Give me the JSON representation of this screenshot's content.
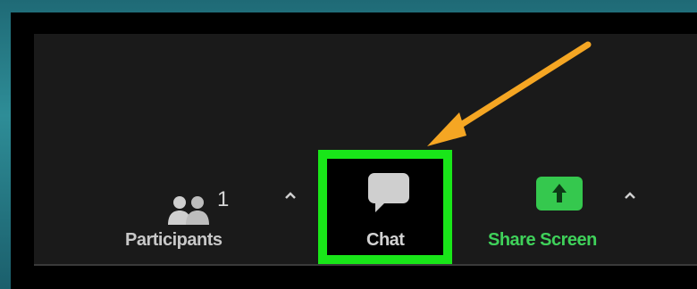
{
  "toolbar": {
    "participants": {
      "label": "Participants",
      "count": "1",
      "icon": "participants-icon"
    },
    "chat": {
      "label": "Chat",
      "icon": "chat-bubble-icon"
    },
    "share_screen": {
      "label": "Share Screen",
      "icon": "share-screen-icon"
    }
  },
  "annotation": {
    "arrow_color": "#f5a623",
    "highlight_color": "#19e619"
  },
  "colors": {
    "share_green": "#3fd15a",
    "toolbar_bg": "#1a1a1a",
    "label_gray": "#c8c8c8"
  }
}
